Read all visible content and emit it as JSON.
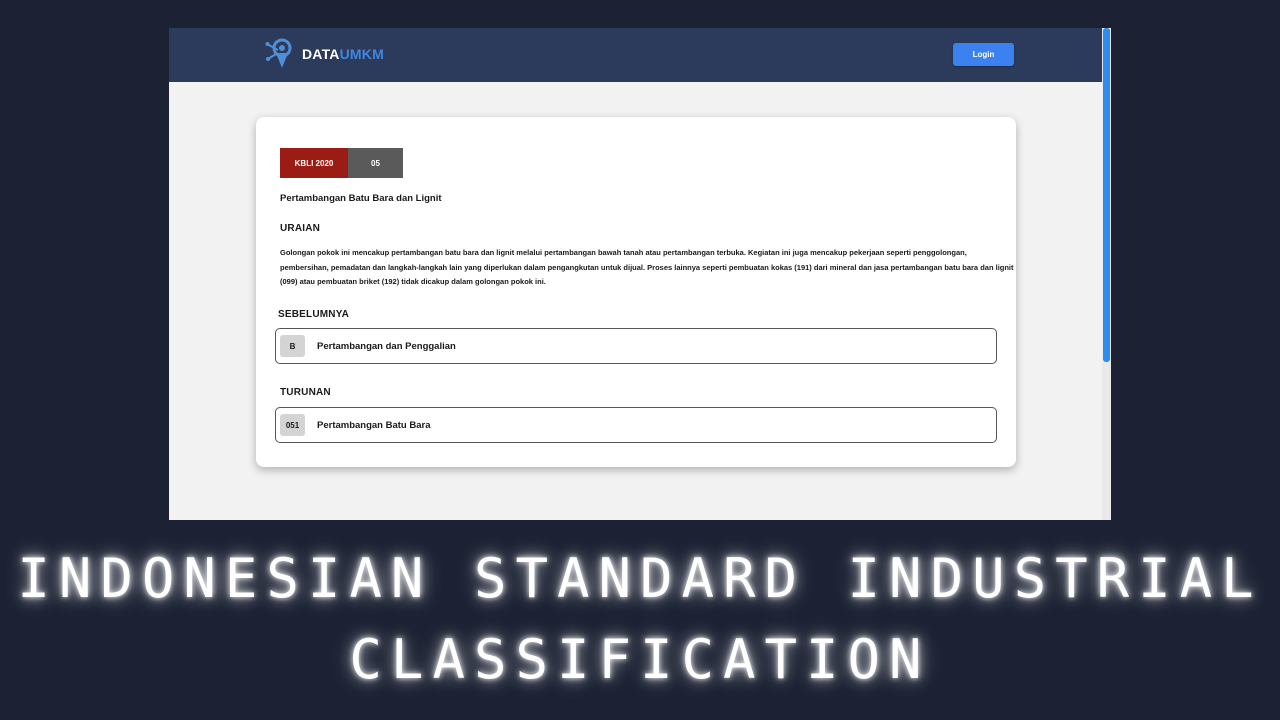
{
  "navbar": {
    "logo_part1": "DATA",
    "logo_part2": "UMKM",
    "login_label": "Login"
  },
  "card": {
    "badge_label": "KBLI 2020",
    "badge_code": "05",
    "title": "Pertambangan Batu Bara dan Lignit",
    "uraian_heading": "URAIAN",
    "description": "Golongan pokok ini mencakup pertambangan batu bara dan lignit melalui pertambangan bawah tanah atau pertambangan terbuka. Kegiatan ini juga mencakup pekerjaan seperti penggolongan, pembersihan, pemadatan dan langkah-langkah lain yang diperlukan dalam pengangkutan untuk dijual. Proses lainnya seperti pembuatan kokas (191) dari mineral dan jasa pertambangan batu bara dan lignit (099) atau pembuatan briket (192) tidak dicakup dalam golongan pokok ini.",
    "previous_heading": "SEBELUMNYA",
    "previous": {
      "code": "B",
      "label": "Pertambangan dan Penggalian"
    },
    "children_heading": "TURUNAN",
    "children": [
      {
        "code": "051",
        "label": "Pertambangan Batu Bara"
      }
    ]
  },
  "caption": {
    "line1": "INDONESIAN STANDARD INDUSTRIAL",
    "line2": "CLASSIFICATION"
  },
  "colors": {
    "page_background": "#1c2233",
    "navbar": "#2c3b5b",
    "logo_accent": "#3f86e6",
    "login_button": "#3b82f0",
    "badge_label": "#9b1c14",
    "badge_code": "#5a5a5a",
    "scrollbar_thumb": "#2d8cf0"
  },
  "icons": {
    "logo": "location-pin-gear-icon"
  }
}
